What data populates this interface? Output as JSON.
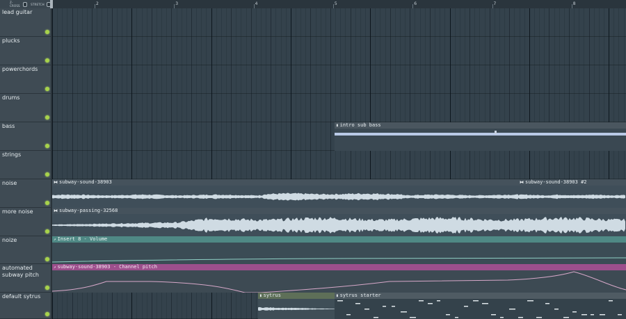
{
  "topbar": {
    "options": [
      {
        "label": "Z-CROSS",
        "checked": false
      },
      {
        "label": "STRETCH",
        "checked": false
      }
    ],
    "bar_numbers": [
      "2",
      "3",
      "4",
      "5",
      "6",
      "7",
      "8"
    ]
  },
  "tracks": [
    {
      "name": "lead guitar"
    },
    {
      "name": "plucks"
    },
    {
      "name": "powerchords"
    },
    {
      "name": "drums"
    },
    {
      "name": "bass"
    },
    {
      "name": "strings"
    },
    {
      "name": "noise"
    },
    {
      "name": "more noise"
    },
    {
      "name": "noize"
    },
    {
      "name": "automated subway pitch"
    },
    {
      "name": "default sytrus"
    }
  ],
  "clips": {
    "intro_sub_bass": {
      "name": "intro sub bass",
      "icon": "pattern-icon"
    },
    "subway_sound": {
      "name": "subway-sound-38903",
      "icon": "audio-icon"
    },
    "subway_sound_2": {
      "name": "subway-sound-38903 #2",
      "icon": "audio-icon"
    },
    "subway_passing": {
      "name": "subway-passing-32568",
      "icon": "audio-icon"
    },
    "insert_volume": {
      "name": "Insert 8 - Volume",
      "icon": "automation-icon"
    },
    "channel_pitch": {
      "name": "subway-sound-38903 - Channel pitch",
      "icon": "automation-icon"
    },
    "sytrus": {
      "name": "sytrus",
      "icon": "pattern-icon"
    },
    "sytrus_starter": {
      "name": "sytrus starter",
      "icon": "pattern-icon"
    }
  },
  "colors": {
    "lane": "#34424c",
    "waveform": "#cfdbe3",
    "automation_teal": "#4f8985",
    "automation_pink": "#9c4f8c",
    "led": "#a7d34a"
  }
}
